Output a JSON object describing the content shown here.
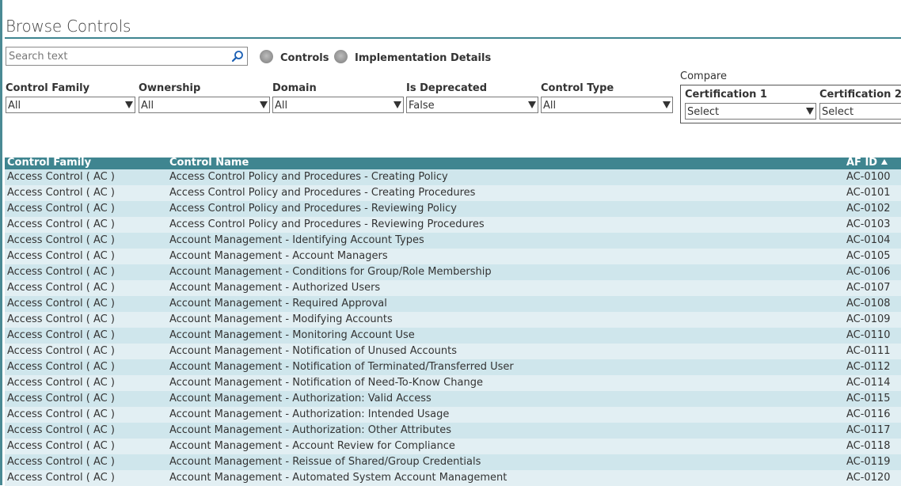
{
  "page": {
    "title": "Browse Controls"
  },
  "search": {
    "placeholder": "Search text",
    "value": ""
  },
  "view_toggle": {
    "options": [
      {
        "label": "Controls"
      },
      {
        "label": "Implementation Details"
      }
    ]
  },
  "filters": [
    {
      "label": "Control Family",
      "value": "All"
    },
    {
      "label": "Ownership",
      "value": "All"
    },
    {
      "label": "Domain",
      "value": "All"
    },
    {
      "label": "Is Deprecated",
      "value": "False"
    },
    {
      "label": "Control Type",
      "value": "All"
    }
  ],
  "compare": {
    "label": "Compare",
    "certifications": [
      {
        "label": "Certification 1",
        "value": "Select"
      },
      {
        "label": "Certification 2",
        "value": "Select"
      }
    ]
  },
  "grid": {
    "columns": [
      "Control Family",
      "Control Name",
      "AF ID"
    ],
    "rows": [
      [
        "Access Control ( AC )",
        "Access Control Policy and Procedures - Creating Policy",
        "AC-0100"
      ],
      [
        "Access Control ( AC )",
        "Access Control Policy and Procedures - Creating Procedures",
        "AC-0101"
      ],
      [
        "Access Control ( AC )",
        "Access Control Policy and Procedures - Reviewing Policy",
        "AC-0102"
      ],
      [
        "Access Control ( AC )",
        "Access Control Policy and Procedures - Reviewing Procedures",
        "AC-0103"
      ],
      [
        "Access Control ( AC )",
        "Account Management - Identifying Account Types",
        "AC-0104"
      ],
      [
        "Access Control ( AC )",
        "Account Management - Account Managers",
        "AC-0105"
      ],
      [
        "Access Control ( AC )",
        "Account Management - Conditions for Group/Role Membership",
        "AC-0106"
      ],
      [
        "Access Control ( AC )",
        "Account Management - Authorized Users",
        "AC-0107"
      ],
      [
        "Access Control ( AC )",
        "Account Management - Required Approval",
        "AC-0108"
      ],
      [
        "Access Control ( AC )",
        "Account Management - Modifying Accounts",
        "AC-0109"
      ],
      [
        "Access Control ( AC )",
        "Account Management - Monitoring Account Use",
        "AC-0110"
      ],
      [
        "Access Control ( AC )",
        "Account Management - Notification of Unused Accounts",
        "AC-0111"
      ],
      [
        "Access Control ( AC )",
        "Account Management - Notification of Terminated/Transferred User",
        "AC-0112"
      ],
      [
        "Access Control ( AC )",
        "Account Management - Notification of Need-To-Know Change",
        "AC-0114"
      ],
      [
        "Access Control ( AC )",
        "Account Management - Authorization: Valid Access",
        "AC-0115"
      ],
      [
        "Access Control ( AC )",
        "Account Management - Authorization: Intended Usage",
        "AC-0116"
      ],
      [
        "Access Control ( AC )",
        "Account Management - Authorization: Other Attributes",
        "AC-0117"
      ],
      [
        "Access Control ( AC )",
        "Account Management - Account Review for Compliance",
        "AC-0118"
      ],
      [
        "Access Control ( AC )",
        "Account Management - Reissue of Shared/Group Credentials",
        "AC-0119"
      ],
      [
        "Access Control ( AC )",
        "Account Management - Automated System Account Management",
        "AC-0120"
      ]
    ]
  },
  "icons": {
    "search": "search-icon",
    "sort": "sort-ascending-icon",
    "dropdown": "chevron-down-icon"
  },
  "colors": {
    "accent": "#3f8590",
    "row_odd": "#cfe6ec",
    "row_even": "#e2eff3"
  }
}
